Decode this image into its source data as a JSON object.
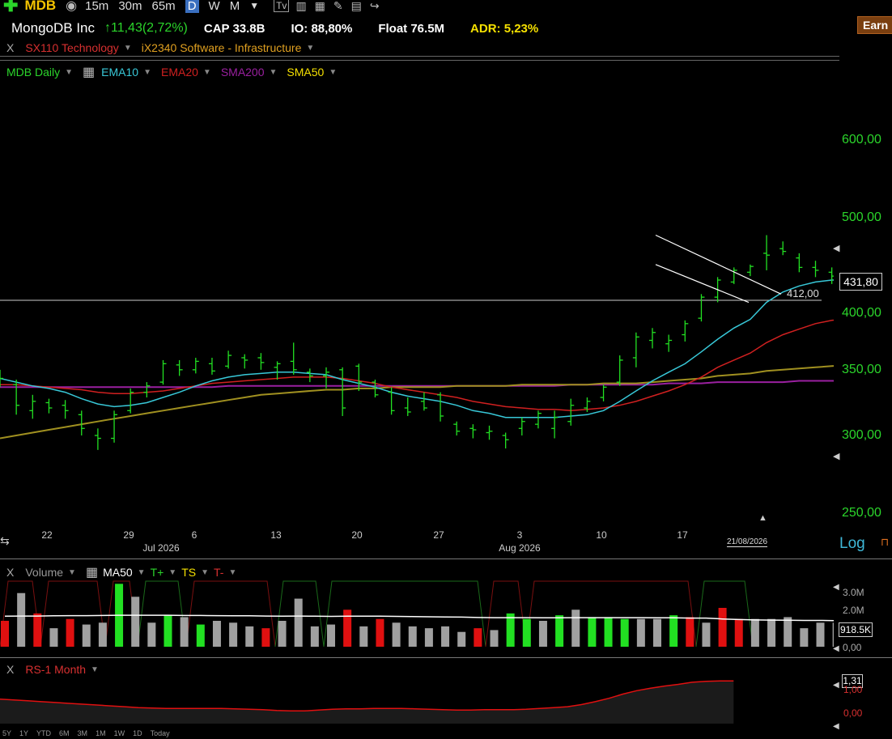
{
  "toolbar": {
    "symbol": "MDB",
    "intervals": [
      "15m",
      "30m",
      "65m"
    ],
    "period_selected": "D",
    "periods": [
      "W",
      "M"
    ]
  },
  "header": {
    "name": "MongoDB Inc",
    "change": "↑11,43(2,72%)",
    "cap": "CAP 33.8B",
    "io": "IO: 88,80%",
    "float": "Float 76.5M",
    "adr": "ADR: 5,23%",
    "earnings_button": "Earn"
  },
  "sector": {
    "close": "X",
    "sector": "SX110 Technology",
    "industry": "iX2340 Software - Infrastructure"
  },
  "indicators": {
    "main": "MDB Daily",
    "ema10": "EMA10",
    "ema20": "EMA20",
    "sma200": "SMA200",
    "sma50": "SMA50"
  },
  "colors": {
    "up": "#22e022",
    "down": "#e01010",
    "neutral": "#a0a0a0",
    "ema10": "#38c8d8",
    "ema20": "#d02020",
    "sma200": "#9a20a0",
    "sma50": "#a09020",
    "ma50_volume": "#ffffff"
  },
  "volume_panel": {
    "close": "X",
    "title": "Volume",
    "ma": "MA50",
    "t_plus": "T+",
    "ts": "TS",
    "t_minus": "T-",
    "ticks": [
      "3.0M",
      "2.0M",
      "0,00"
    ],
    "current": "918.5K"
  },
  "rs_panel": {
    "close": "X",
    "title": "RS-1 Month",
    "ticks": [
      "1,00",
      "0,00"
    ],
    "current": "1,31"
  },
  "price_axis": {
    "ticks": [
      "600,00",
      "500,00",
      "400,00",
      "350,00",
      "300,00",
      "250,00"
    ],
    "last_price": "431,80",
    "hline_label": "412,00",
    "log_label": "Log"
  },
  "date_axis": {
    "days": [
      "22",
      "29",
      "6",
      "13",
      "20",
      "27",
      "3",
      "10",
      "17"
    ],
    "months": [
      "Jul 2026",
      "Aug 2026"
    ],
    "last_date": "21/08/2026"
  },
  "time_periods": [
    "5Y",
    "1Y",
    "YTD",
    "6M",
    "3M",
    "1M",
    "1W",
    "1D",
    "Today"
  ],
  "chart_data": {
    "type": "bar",
    "scale": "log",
    "ylim": [
      240,
      650
    ],
    "hline": 412,
    "bars": [
      {
        "o": 346,
        "h": 350,
        "l": 336,
        "c": 343
      },
      {
        "o": 338,
        "h": 342,
        "l": 315,
        "c": 322
      },
      {
        "o": 318,
        "h": 330,
        "l": 312,
        "c": 325
      },
      {
        "o": 324,
        "h": 327,
        "l": 316,
        "c": 320
      },
      {
        "o": 322,
        "h": 326,
        "l": 312,
        "c": 318
      },
      {
        "o": 315,
        "h": 318,
        "l": 300,
        "c": 305
      },
      {
        "o": 300,
        "h": 305,
        "l": 290,
        "c": 298
      },
      {
        "o": 298,
        "h": 318,
        "l": 295,
        "c": 315
      },
      {
        "o": 318,
        "h": 335,
        "l": 316,
        "c": 332
      },
      {
        "o": 332,
        "h": 340,
        "l": 328,
        "c": 337
      },
      {
        "o": 340,
        "h": 358,
        "l": 338,
        "c": 355
      },
      {
        "o": 354,
        "h": 358,
        "l": 345,
        "c": 350
      },
      {
        "o": 350,
        "h": 360,
        "l": 347,
        "c": 357
      },
      {
        "o": 355,
        "h": 360,
        "l": 346,
        "c": 349
      },
      {
        "o": 353,
        "h": 366,
        "l": 351,
        "c": 362
      },
      {
        "o": 360,
        "h": 363,
        "l": 351,
        "c": 358
      },
      {
        "o": 360,
        "h": 364,
        "l": 350,
        "c": 356
      },
      {
        "o": 352,
        "h": 357,
        "l": 342,
        "c": 355
      },
      {
        "o": 357,
        "h": 373,
        "l": 346,
        "c": 350
      },
      {
        "o": 348,
        "h": 351,
        "l": 340,
        "c": 345
      },
      {
        "o": 345,
        "h": 352,
        "l": 335,
        "c": 348
      },
      {
        "o": 350,
        "h": 352,
        "l": 314,
        "c": 320
      },
      {
        "o": 353,
        "h": 355,
        "l": 333,
        "c": 340
      },
      {
        "o": 340,
        "h": 342,
        "l": 328,
        "c": 330
      },
      {
        "o": 332,
        "h": 336,
        "l": 315,
        "c": 318
      },
      {
        "o": 320,
        "h": 328,
        "l": 314,
        "c": 317
      },
      {
        "o": 325,
        "h": 332,
        "l": 318,
        "c": 320
      },
      {
        "o": 330,
        "h": 332,
        "l": 310,
        "c": 314
      },
      {
        "o": 308,
        "h": 310,
        "l": 300,
        "c": 303
      },
      {
        "o": 305,
        "h": 308,
        "l": 298,
        "c": 304
      },
      {
        "o": 302,
        "h": 307,
        "l": 297,
        "c": 303
      },
      {
        "o": 300,
        "h": 302,
        "l": 291,
        "c": 297
      },
      {
        "o": 305,
        "h": 313,
        "l": 300,
        "c": 310
      },
      {
        "o": 308,
        "h": 318,
        "l": 305,
        "c": 316
      },
      {
        "o": 305,
        "h": 318,
        "l": 298,
        "c": 313
      },
      {
        "o": 310,
        "h": 327,
        "l": 307,
        "c": 322
      },
      {
        "o": 320,
        "h": 328,
        "l": 317,
        "c": 325
      },
      {
        "o": 328,
        "h": 338,
        "l": 325,
        "c": 336
      },
      {
        "o": 340,
        "h": 362,
        "l": 337,
        "c": 358
      },
      {
        "o": 360,
        "h": 382,
        "l": 352,
        "c": 378
      },
      {
        "o": 375,
        "h": 386,
        "l": 368,
        "c": 382
      },
      {
        "o": 372,
        "h": 380,
        "l": 365,
        "c": 375
      },
      {
        "o": 380,
        "h": 393,
        "l": 374,
        "c": 390
      },
      {
        "o": 395,
        "h": 418,
        "l": 392,
        "c": 415
      },
      {
        "o": 415,
        "h": 435,
        "l": 410,
        "c": 432
      },
      {
        "o": 430,
        "h": 445,
        "l": 428,
        "c": 442
      },
      {
        "o": 440,
        "h": 448,
        "l": 436,
        "c": 446
      },
      {
        "o": 460,
        "h": 480,
        "l": 442,
        "c": 458
      },
      {
        "o": 465,
        "h": 473,
        "l": 458,
        "c": 462
      },
      {
        "o": 455,
        "h": 460,
        "l": 440,
        "c": 445
      },
      {
        "o": 445,
        "h": 452,
        "l": 435,
        "c": 442
      },
      {
        "o": 440,
        "h": 445,
        "l": 428,
        "c": 436
      },
      {
        "o": 435,
        "h": 440,
        "l": 425,
        "c": 430
      },
      {
        "o": 420,
        "h": 444,
        "l": 412,
        "c": 432
      }
    ],
    "ema10": [
      343,
      340,
      337,
      335,
      332,
      327,
      323,
      321,
      322,
      324,
      328,
      332,
      337,
      341,
      344,
      346,
      347,
      348,
      348,
      347,
      346,
      342,
      339,
      336,
      332,
      329,
      327,
      325,
      322,
      318,
      316,
      313,
      313,
      313,
      313,
      314,
      315,
      318,
      325,
      333,
      341,
      348,
      355,
      365,
      376,
      386,
      394,
      410,
      420,
      426,
      430,
      432,
      432,
      432
    ],
    "ema20": [
      338,
      338,
      337,
      336,
      335,
      334,
      332,
      331,
      331,
      332,
      333,
      335,
      337,
      339,
      340,
      341,
      342,
      343,
      344,
      344,
      344,
      343,
      341,
      339,
      336,
      334,
      332,
      330,
      328,
      325,
      323,
      321,
      320,
      319,
      319,
      318,
      319,
      320,
      322,
      325,
      329,
      333,
      338,
      344,
      352,
      358,
      364,
      373,
      380,
      385,
      390,
      393,
      395,
      398
    ],
    "sma50": [
      298,
      300,
      302,
      304,
      306,
      308,
      310,
      312,
      314,
      316,
      318,
      320,
      322,
      324,
      326,
      328,
      330,
      331,
      332,
      333,
      334,
      334,
      335,
      335,
      336,
      336,
      336,
      336,
      337,
      337,
      337,
      337,
      338,
      338,
      338,
      338,
      338,
      339,
      339,
      339,
      340,
      341,
      342,
      343,
      345,
      346,
      347,
      349,
      350,
      351,
      352,
      353,
      354,
      356
    ],
    "sma200": [
      336,
      336,
      336,
      336,
      336,
      336,
      336,
      336,
      336,
      336,
      336,
      336,
      336,
      336,
      337,
      337,
      337,
      337,
      337,
      337,
      337,
      337,
      337,
      337,
      337,
      337,
      337,
      337,
      337,
      337,
      337,
      337,
      337,
      337,
      337,
      338,
      338,
      338,
      338,
      338,
      338,
      339,
      339,
      339,
      340,
      340,
      340,
      340,
      340,
      341,
      341,
      341,
      341,
      341
    ],
    "trendlines": [
      {
        "from": [
          47,
          480
        ],
        "to": [
          56,
          418
        ]
      },
      {
        "from": [
          47,
          448
        ],
        "to": [
          56,
          410
        ]
      }
    ],
    "volume": {
      "values": [
        1.4,
        2.9,
        1.8,
        1.0,
        1.5,
        1.2,
        1.3,
        3.4,
        2.7,
        1.3,
        1.7,
        1.6,
        1.2,
        1.4,
        1.3,
        1.1,
        1.0,
        1.4,
        2.6,
        1.1,
        1.2,
        2.0,
        1.1,
        1.5,
        1.3,
        1.1,
        1.0,
        1.1,
        0.8,
        1.0,
        0.9,
        1.8,
        1.5,
        1.4,
        1.7,
        2.0,
        1.6,
        1.6,
        1.5,
        1.5,
        1.5,
        1.7,
        1.6,
        1.3,
        2.1,
        1.5,
        1.5,
        1.5,
        1.6,
        1.0,
        1.3,
        1.3,
        0.9
      ],
      "ma50": [
        1.65,
        1.66,
        1.66,
        1.67,
        1.68,
        1.68,
        1.69,
        1.7,
        1.7,
        1.7,
        1.7,
        1.69,
        1.69,
        1.68,
        1.67,
        1.67,
        1.66,
        1.65,
        1.66,
        1.65,
        1.64,
        1.65,
        1.65,
        1.65,
        1.64,
        1.63,
        1.62,
        1.61,
        1.6,
        1.58,
        1.57,
        1.57,
        1.57,
        1.56,
        1.56,
        1.57,
        1.57,
        1.57,
        1.57,
        1.57,
        1.56,
        1.56,
        1.55,
        1.55,
        1.5,
        1.47,
        1.45,
        1.44,
        1.43,
        1.42,
        1.42,
        1.41,
        1.4
      ],
      "ylim": [
        0,
        3.5
      ]
    },
    "rs": {
      "values": [
        0.88,
        0.86,
        0.84,
        0.82,
        0.8,
        0.78,
        0.76,
        0.74,
        0.72,
        0.7,
        0.68,
        0.67,
        0.66,
        0.66,
        0.66,
        0.66,
        0.66,
        0.65,
        0.64,
        0.63,
        0.61,
        0.6,
        0.6,
        0.62,
        0.64,
        0.65,
        0.65,
        0.66,
        0.66,
        0.66,
        0.65,
        0.64,
        0.63,
        0.62,
        0.62,
        0.63,
        0.63,
        0.63,
        0.64,
        0.66,
        0.68,
        0.7,
        0.75,
        0.82,
        0.9,
        1.0,
        1.08,
        1.14,
        1.19,
        1.23,
        1.28,
        1.3,
        1.31,
        1.31
      ],
      "ylim": [
        0.3,
        1.45
      ]
    }
  }
}
